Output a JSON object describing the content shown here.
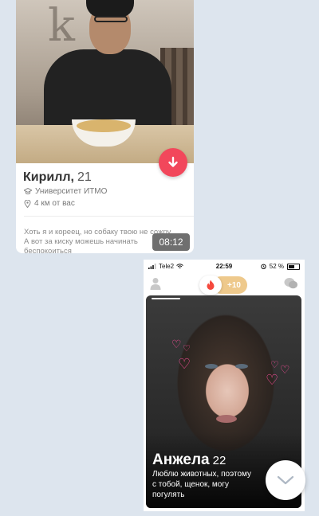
{
  "top_card": {
    "name": "Кирилл,",
    "age": "21",
    "university": "Университет ИТМО",
    "distance": "4 км от вас",
    "bio_line1": "Хоть я и кореец, но собаку твою не сожру",
    "bio_line2": "А вот за киску можешь начинать",
    "bio_line3": "беспокоиться",
    "timestamp": "08:12",
    "accent_color": "#f2475b"
  },
  "status_bar": {
    "carrier": "Tele2",
    "time": "22:59",
    "battery": "52 %"
  },
  "app_bar": {
    "boost_count": "+10",
    "boost_color": "#eec98c"
  },
  "bottom_card": {
    "name": "Анжела",
    "age": "22",
    "bio_line1": "Люблю животных, поэтому",
    "bio_line2": "с тобой, щенок, могу",
    "bio_line3": "погулять"
  },
  "icons": {
    "down_arrow": "arrow-down-icon",
    "expand": "chevron-down-icon",
    "flame": "flame-icon"
  }
}
